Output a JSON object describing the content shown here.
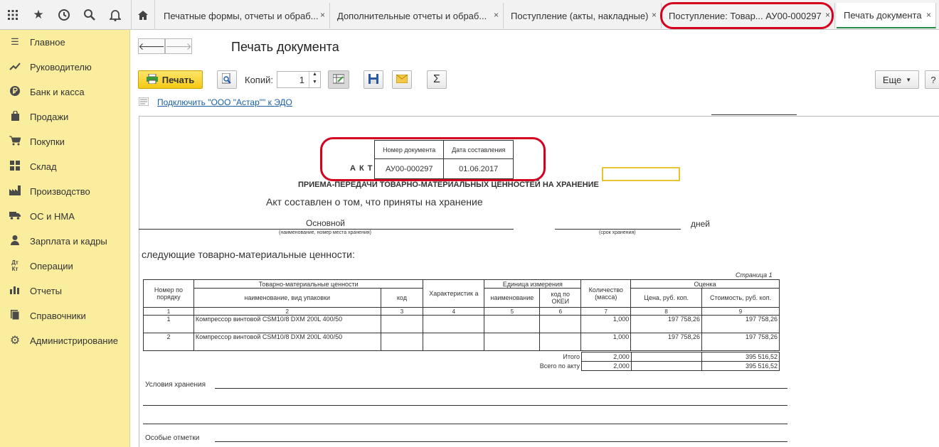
{
  "topbar": {
    "tabs": [
      {
        "label": "Печатные формы, отчеты и обраб..."
      },
      {
        "label": "Дополнительные отчеты и обраб..."
      },
      {
        "label": "Поступление (акты, накладные)"
      },
      {
        "label": "Поступление: Товар... АУ00-000297"
      },
      {
        "label": "Печать документа"
      }
    ],
    "close_glyph": "×"
  },
  "sidebar": {
    "items": [
      {
        "label": "Главное",
        "icon": "menu-icon"
      },
      {
        "label": "Руководителю",
        "icon": "trend-icon"
      },
      {
        "label": "Банк и касса",
        "icon": "ruble-icon"
      },
      {
        "label": "Продажи",
        "icon": "bag-icon"
      },
      {
        "label": "Покупки",
        "icon": "cart-icon"
      },
      {
        "label": "Склад",
        "icon": "grid-icon"
      },
      {
        "label": "Производство",
        "icon": "factory-icon"
      },
      {
        "label": "ОС и НМА",
        "icon": "truck-icon"
      },
      {
        "label": "Зарплата и кадры",
        "icon": "person-icon"
      },
      {
        "label": "Операции",
        "icon": "dtkt-icon"
      },
      {
        "label": "Отчеты",
        "icon": "bar-chart-icon"
      },
      {
        "label": "Справочники",
        "icon": "book-icon"
      },
      {
        "label": "Администрирование",
        "icon": "gear-icon"
      }
    ]
  },
  "page": {
    "title": "Печать документа",
    "print_label": "Печать",
    "copies_label": "Копий:",
    "copies_value": "1",
    "more_label": "Еще",
    "help_label": "?",
    "sigma": "Σ",
    "edo_link": "Подключить \"ООО \"Астар\"\" к ЭДО"
  },
  "doc": {
    "hdr_num_label": "Номер документа",
    "hdr_date_label": "Дата составления",
    "act_label": "А К Т",
    "doc_number": "АУ00-000297",
    "doc_date": "01.06.2017",
    "subtitle": "ПРИЕМА-ПЕРЕДАЧИ ТОВАРНО-МАТЕРИАЛЬНЫХ ЦЕННОСТЕЙ НА ХРАНЕНИЕ",
    "intro": "Акт составлен о том, что приняты на хранение",
    "storage_place": "Основной",
    "storage_place_caption": "(наименование, номер места хранения)",
    "term_caption": "(срок хранения)",
    "days": "дней",
    "following": "следующие товарно-материальные ценности:",
    "page_label": "Страница 1",
    "cols": {
      "num": "Номер по порядку",
      "tmc": "Товарно-материальные ценности",
      "name": "наименование, вид упаковки",
      "code": "код",
      "char": "Характеристик а",
      "unit": "Единица измерения",
      "unit_name": "наименование",
      "okei": "код по ОКЕИ",
      "qty": "Количество (масса)",
      "eval": "Оценка",
      "price": "Цена, руб. коп.",
      "cost": "Стоимость, руб. коп."
    },
    "col_numbers": [
      "1",
      "2",
      "3",
      "4",
      "5",
      "6",
      "7",
      "8",
      "9"
    ],
    "rows": [
      {
        "n": "1",
        "name": "Компрессор винтовой CSM10/8 DXM 200L 400/50",
        "qty": "1,000",
        "price": "197 758,26",
        "cost": "197 758,26"
      },
      {
        "n": "2",
        "name": "Компрессор винтовой CSM10/8 DXM 200L 400/50",
        "qty": "1,000",
        "price": "197 758,26",
        "cost": "197 758,26"
      }
    ],
    "total_label": "Итого",
    "total_qty": "2,000",
    "total_cost": "395 516,52",
    "grand_label": "Всего по акту",
    "grand_qty": "2,000",
    "grand_cost": "395 516,52",
    "conditions_label": "Условия хранения",
    "notes_label": "Особые отметки"
  }
}
